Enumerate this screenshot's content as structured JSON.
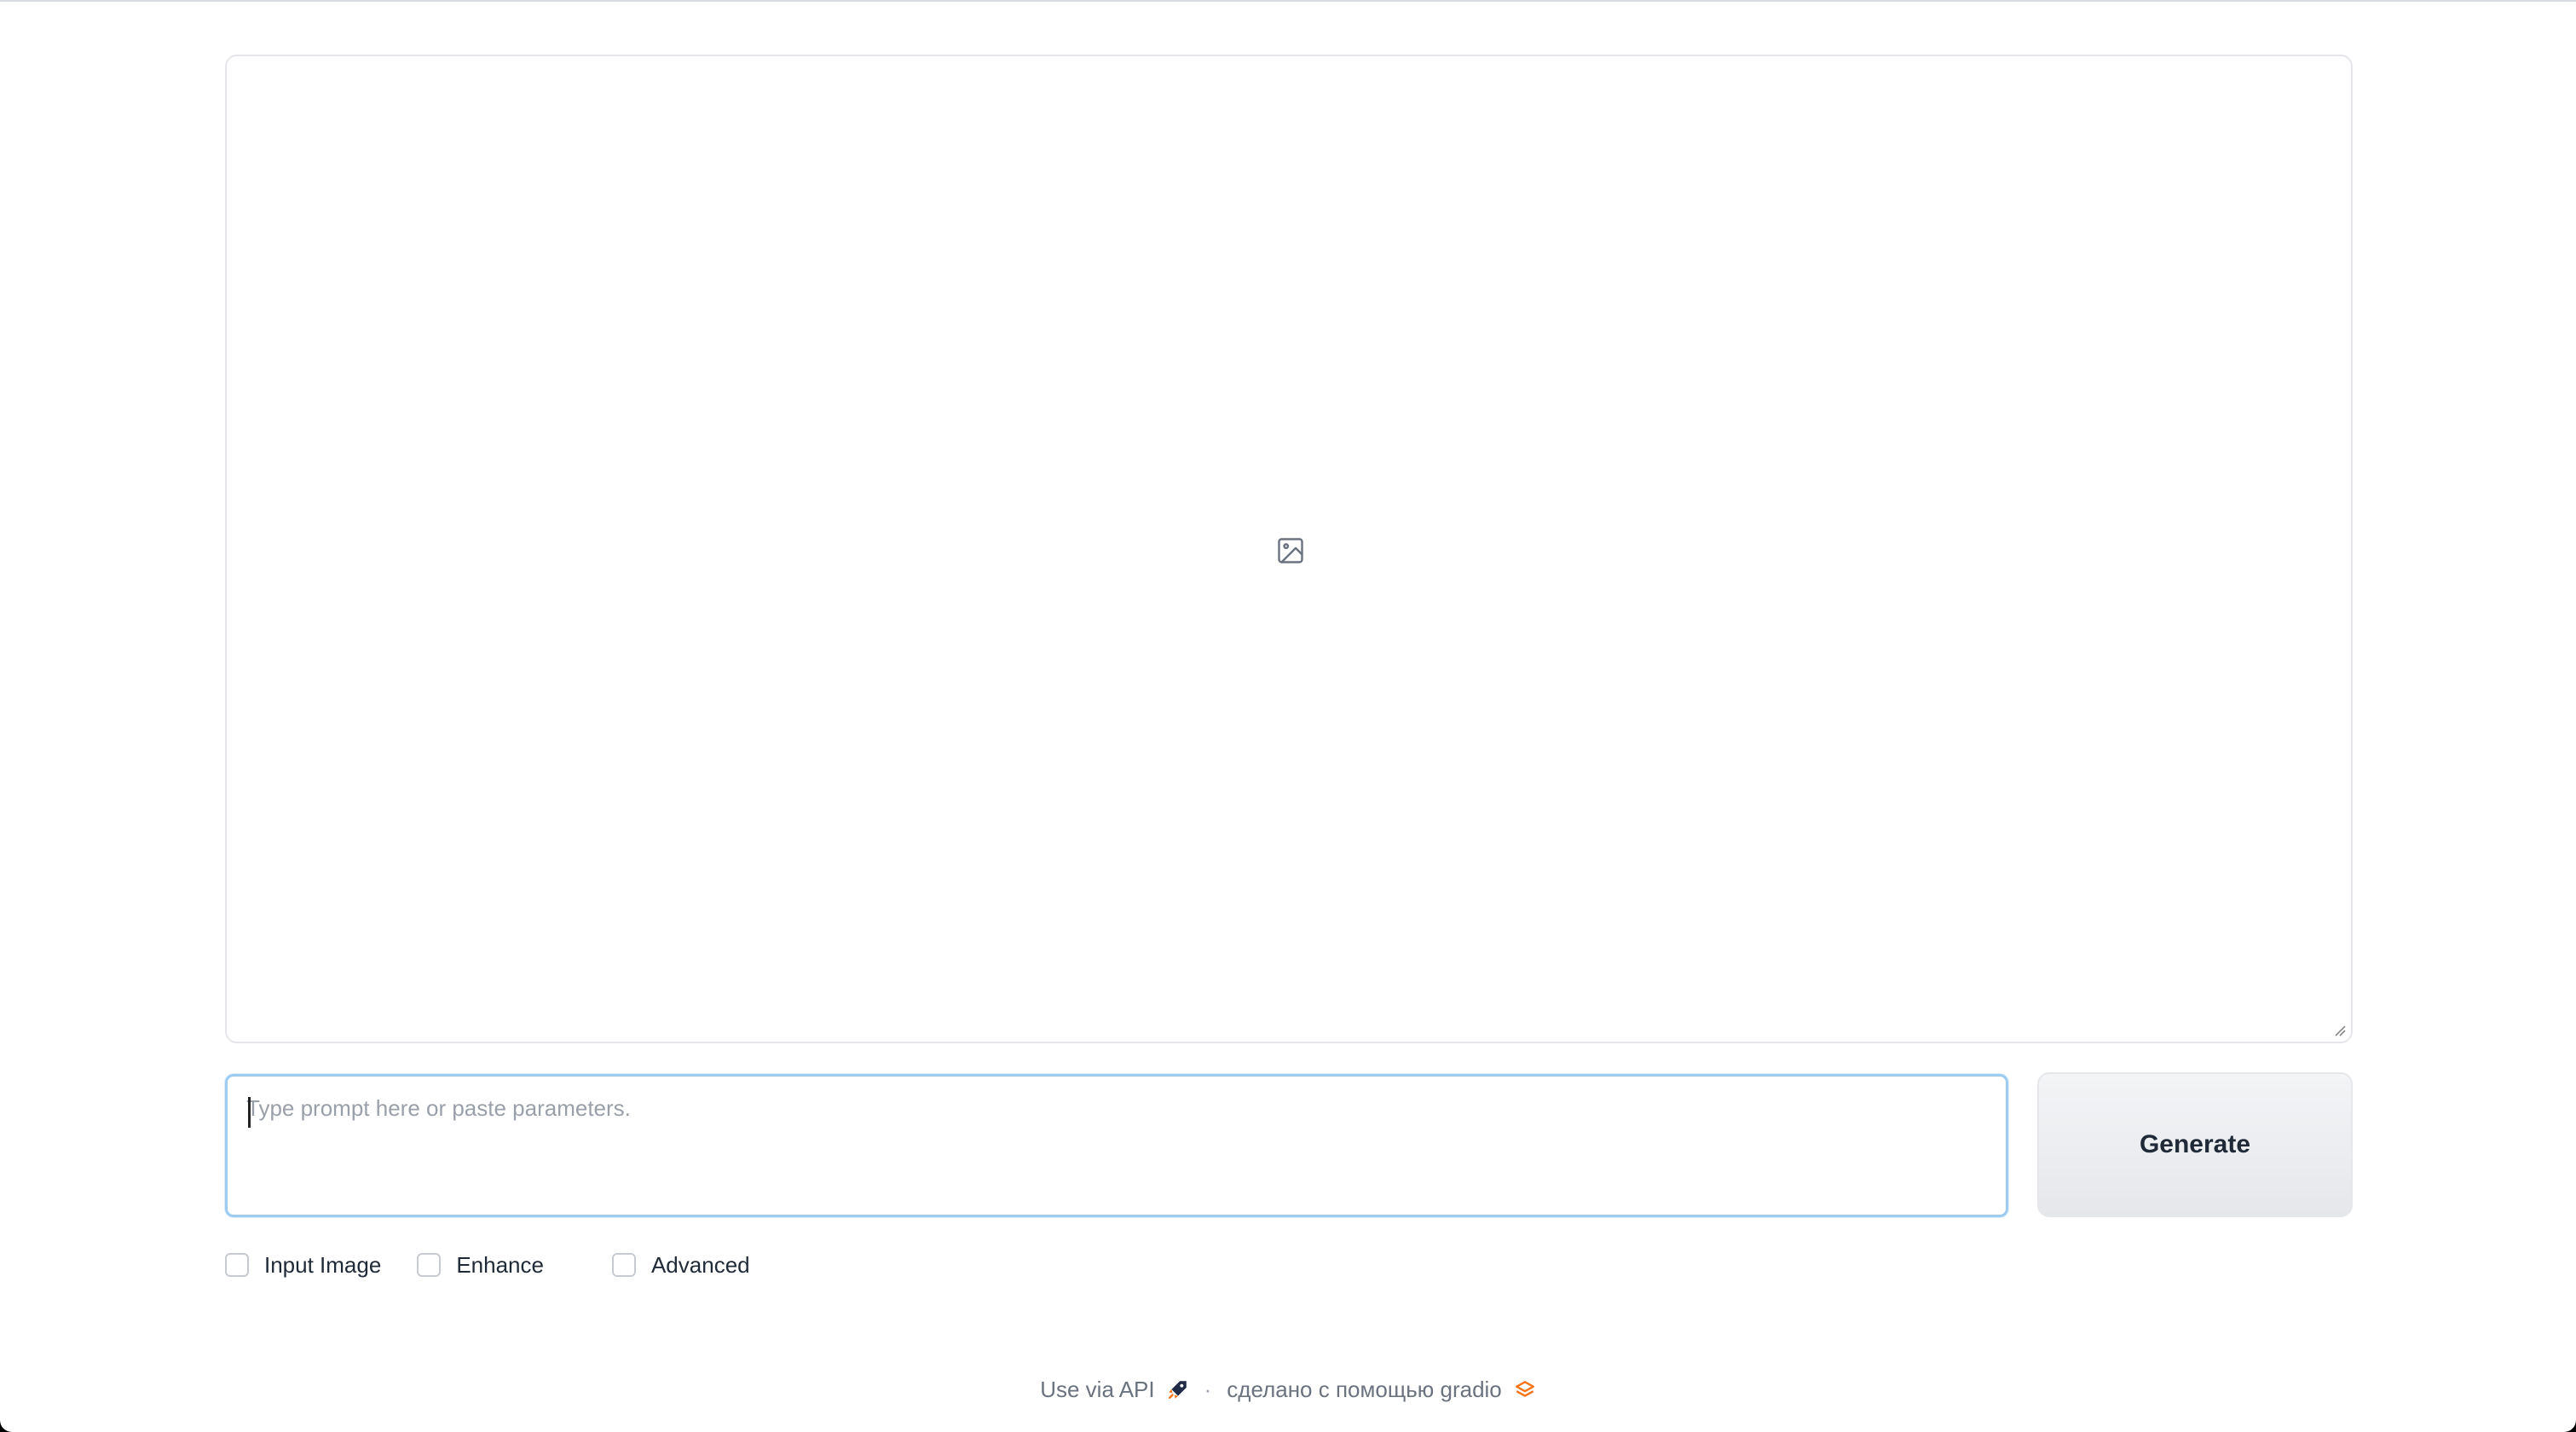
{
  "gallery": {
    "placeholder_icon": "image-icon"
  },
  "prompt": {
    "placeholder": "Type prompt here or paste parameters.",
    "value": ""
  },
  "generate": {
    "label": "Generate"
  },
  "options": [
    {
      "label": "Input Image",
      "checked": false
    },
    {
      "label": "Enhance",
      "checked": false
    },
    {
      "label": "Advanced",
      "checked": false
    }
  ],
  "footer": {
    "api_label": "Use via API",
    "api_icon": "rocket-icon",
    "separator": "·",
    "built_with": "сделано с помощью gradio",
    "gradio_icon": "gradio-logo-icon"
  },
  "colors": {
    "prompt_focus_border": "#9ecbf0",
    "button_bg": "#e5e7eb",
    "gradio_orange": "#f97316"
  }
}
